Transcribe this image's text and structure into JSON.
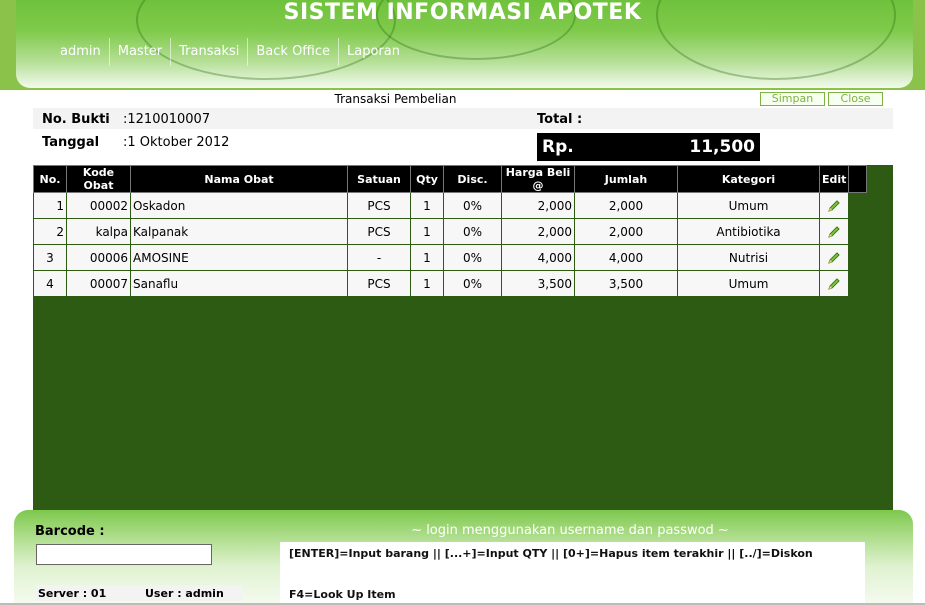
{
  "app": {
    "title": "SISTEM INFORMASI APOTEK"
  },
  "nav": [
    {
      "label": "admin"
    },
    {
      "label": "Master"
    },
    {
      "label": "Transaksi"
    },
    {
      "label": "Back Office"
    },
    {
      "label": "Laporan"
    }
  ],
  "form": {
    "title": "Transaksi Pembelian",
    "save_label": "Simpan",
    "close_label": "Close",
    "bukti_label": "No. Bukti",
    "bukti_value": ":1210010007",
    "tanggal_label": "Tanggal",
    "tanggal_value": ":1 Oktober 2012",
    "total_label": "Total :",
    "total_prefix": "Rp.",
    "total_value": "11,500"
  },
  "table": {
    "headers": [
      "No.",
      "Kode Obat",
      "Nama Obat",
      "Satuan",
      "Qty",
      "Disc.",
      "Harga Beli @",
      "Jumlah",
      "Kategori",
      "Edit"
    ],
    "rows": [
      {
        "no": "1",
        "kode": "00002",
        "nama": "Oskadon",
        "satuan": "PCS",
        "qty": "1",
        "disc": "0%",
        "harga": "2,000",
        "jumlah": "2,000",
        "kategori": "Umum"
      },
      {
        "no": "2",
        "kode": "kalpa",
        "nama": "Kalpanak",
        "satuan": "PCS",
        "qty": "1",
        "disc": "0%",
        "harga": "2,000",
        "jumlah": "2,000",
        "kategori": "Antibiotika"
      },
      {
        "no": "3",
        "kode": "00006",
        "nama": "AMOSINE",
        "satuan": "-",
        "qty": "1",
        "disc": "0%",
        "harga": "4,000",
        "jumlah": "4,000",
        "kategori": "Nutrisi"
      },
      {
        "no": "4",
        "kode": "00007",
        "nama": "Sanaflu",
        "satuan": "PCS",
        "qty": "1",
        "disc": "0%",
        "harga": "3,500",
        "jumlah": "3,500",
        "kategori": "Umum"
      }
    ]
  },
  "bottom": {
    "barcode_label": "Barcode :",
    "barcode_value": "",
    "server": "Server : 01",
    "user": "User : admin",
    "help_title": "~ login menggunakan username dan passwod ~",
    "help_line1": "[ENTER]=Input barang || [...+]=Input QTY || [0+]=Hapus item terakhir || [../]=Diskon",
    "help_line2": "F4=Look Up Item"
  },
  "colors": {
    "header_green": "#6fc23c",
    "table_bg": "#2e5b13",
    "header_black": "#000000",
    "button_border": "#7cb342"
  },
  "icons": {
    "edit": "pencil-icon"
  }
}
